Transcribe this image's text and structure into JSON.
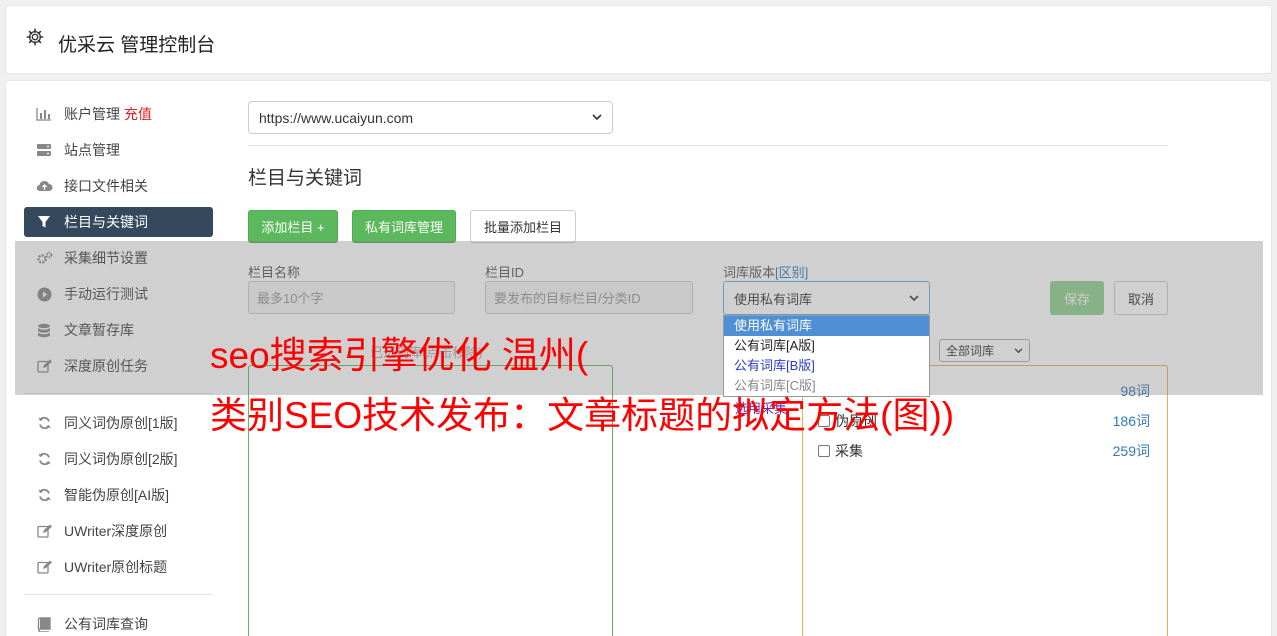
{
  "header": {
    "title": "优采云 管理控制台"
  },
  "sidebar": {
    "items": [
      {
        "label": "账户管理",
        "badge": "充值",
        "icon": "bar-chart-icon"
      },
      {
        "label": "站点管理",
        "icon": "server-icon"
      },
      {
        "label": "接口文件相关",
        "icon": "cloud-upload-icon"
      },
      {
        "label": "栏目与关键词",
        "icon": "filter-icon",
        "active": true
      },
      {
        "label": "采集细节设置",
        "icon": "cogs-icon"
      },
      {
        "label": "手动运行测试",
        "icon": "play-circle-icon"
      },
      {
        "label": "文章暂存库",
        "icon": "database-icon"
      },
      {
        "label": "深度原创任务",
        "icon": "edit-icon"
      },
      {
        "label": "同义词伪原创[1版]",
        "icon": "refresh-icon"
      },
      {
        "label": "同义词伪原创[2版]",
        "icon": "refresh-icon"
      },
      {
        "label": "智能伪原创[AI版]",
        "icon": "refresh-icon"
      },
      {
        "label": "UWriter深度原创",
        "icon": "edit-icon"
      },
      {
        "label": "UWriter原创标题",
        "icon": "edit-icon"
      },
      {
        "label": "公有词库查询",
        "icon": "book-icon"
      }
    ]
  },
  "main": {
    "site_url": "https://www.ucaiyun.com",
    "section_title": "栏目与关键词",
    "buttons": {
      "add_column": "添加栏目 +",
      "private_lib": "私有词库管理",
      "batch_add": "批量添加栏目"
    },
    "form": {
      "name_label": "栏目名称",
      "name_placeholder": "最多10个字",
      "id_label": "栏目ID",
      "id_placeholder": "要发布的目标栏目/分类ID",
      "version_label": "词库版本",
      "version_diff": "[区别]",
      "version_selected": "使用私有词库",
      "version_options": [
        "使用私有词库",
        "公有词库[A版]",
        "公有词库[B版]",
        "公有词库[C版]"
      ],
      "save": "保存",
      "cancel": "取消"
    },
    "hint": "已选词库(点击移除)",
    "collect_link": "选用采集",
    "filter_all": "全部词库",
    "libraries": [
      {
        "name": "伪原创",
        "count": "98词"
      },
      {
        "name": "伪原创",
        "count": "186词"
      },
      {
        "name": "采集",
        "count": "259词"
      }
    ]
  },
  "watermark": {
    "line1": "seo搜索引擎优化 温州(",
    "line2": "类别SEO技术发布：文章标题的拟定方法(图))"
  },
  "colors": {
    "active_nav": "#34495e",
    "primary_green": "#5cb85c",
    "watermark": "#ff0000"
  }
}
